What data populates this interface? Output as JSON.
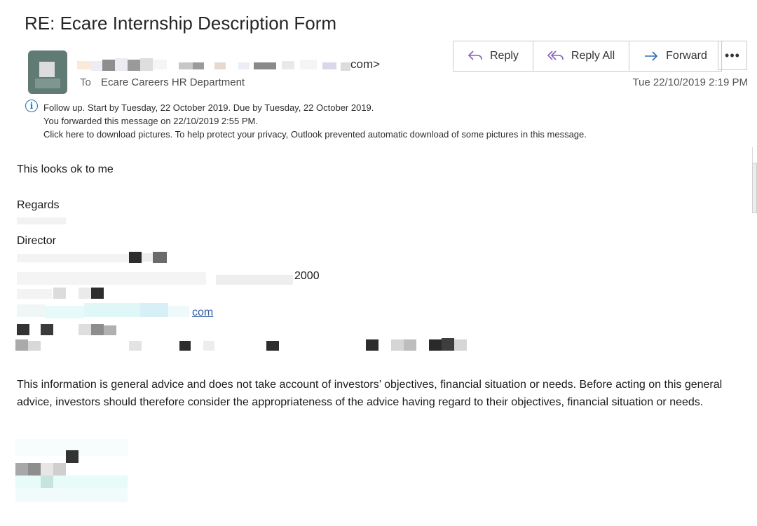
{
  "subject": "RE: Ecare Internship Description Form",
  "sender": {
    "suffix": "com>"
  },
  "recipient": {
    "to_label": "To",
    "name": "Ecare Careers HR Department"
  },
  "date": "Tue 22/10/2019 2:19 PM",
  "actions": {
    "reply": "Reply",
    "reply_all": "Reply All",
    "forward": "Forward",
    "more": "•••"
  },
  "info": {
    "icon": "info-icon",
    "lines": [
      "Follow up.  Start by Tuesday, 22 October 2019.  Due by Tuesday, 22 October 2019.",
      "You forwarded this message on 22/10/2019 2:55 PM.",
      "Click here to download pictures. To help protect your privacy, Outlook prevented automatic download of some pictures in this message."
    ]
  },
  "body": {
    "line1": "This looks ok to me",
    "regards": "Regards",
    "title": "Director",
    "address_tail": "2000",
    "link_tail": "com",
    "disclaimer": "This information is general advice and does not take account of investors’ objectives, financial situation or needs. Before acting on this general advice, investors should therefore consider the appropriateness of the advice having regard to their objectives, financial situation or needs."
  },
  "colors": {
    "accent_blue": "#2a6cc4",
    "reply_purple": "#8a5cc8",
    "link": "#2f5faf"
  }
}
